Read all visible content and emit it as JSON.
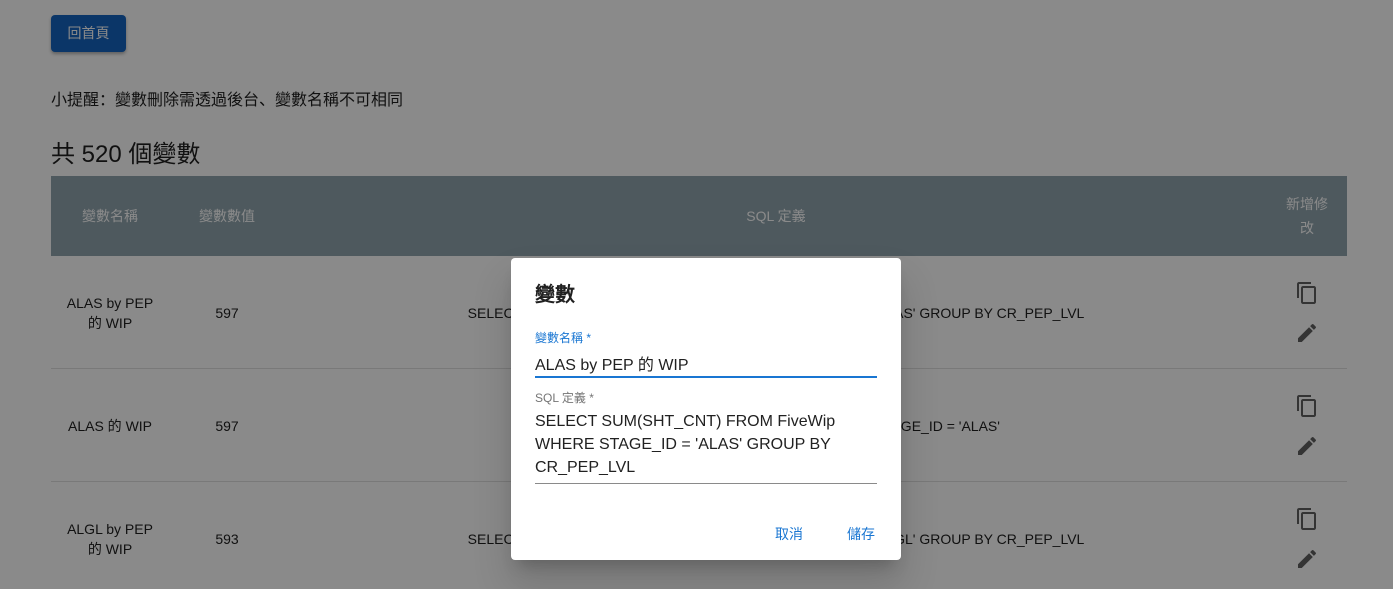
{
  "home_button": "回首頁",
  "tip": "小提醒：變數刪除需透過後台、變數名稱不可相同",
  "count_title": "共 520 個變數",
  "table": {
    "headers": {
      "name": "變數名稱",
      "value": "變數數值",
      "sql": "SQL 定義",
      "edit": "新增修改"
    },
    "rows": [
      {
        "name": "ALAS by PEP 的 WIP",
        "value": "597",
        "sql": "SELECT SUM(SHT_CNT) FROM FiveWip WHERE STAGE_ID = 'ALAS' GROUP BY CR_PEP_LVL"
      },
      {
        "name": "ALAS 的 WIP",
        "value": "597",
        "sql": "SELECT SUM(SHT_CNT) FROM FiveWip WHERE STAGE_ID = 'ALAS'"
      },
      {
        "name": "ALGL by PEP 的 WIP",
        "value": "593",
        "sql": "SELECT SUM(SHT_CNT) FROM FiveWip WHERE STAGE_ID = 'ALGL' GROUP BY CR_PEP_LVL"
      }
    ]
  },
  "dialog": {
    "title": "變數",
    "name_label": "變數名稱 *",
    "name_value": "ALAS by PEP 的 WIP",
    "sql_label": "SQL 定義 *",
    "sql_value": "SELECT SUM(SHT_CNT) FROM FiveWip WHERE STAGE_ID = 'ALAS' GROUP BY CR_PEP_LVL",
    "cancel": "取消",
    "save": "儲存"
  },
  "colors": {
    "primary": "#1565c0",
    "accent": "#1976d2",
    "header_bg": "#90a4ae"
  }
}
